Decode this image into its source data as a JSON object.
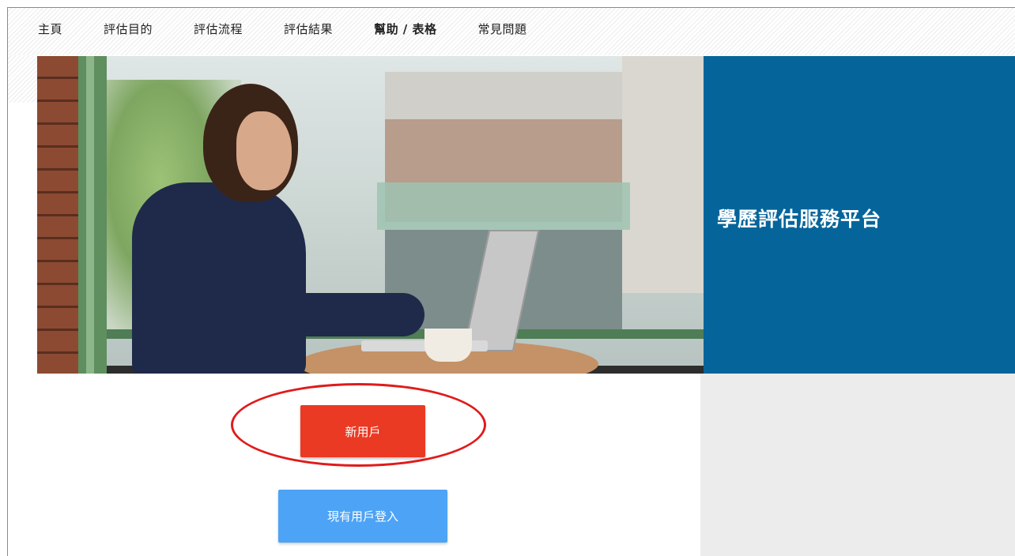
{
  "nav": {
    "items": [
      {
        "label": "主頁"
      },
      {
        "label": "評估目的"
      },
      {
        "label": "評估流程"
      },
      {
        "label": "評估結果"
      },
      {
        "label": "幫助 / 表格"
      },
      {
        "label": "常見問題"
      }
    ]
  },
  "hero": {
    "title": "學歷評估服務平台"
  },
  "actions": {
    "new_user_label": "新用戶",
    "existing_user_login_label": "現有用戶登入"
  },
  "colors": {
    "panel_blue": "#05659b",
    "new_user_red": "#ea3a24",
    "login_blue": "#4da3f5",
    "highlight_red": "#e01b1b"
  }
}
